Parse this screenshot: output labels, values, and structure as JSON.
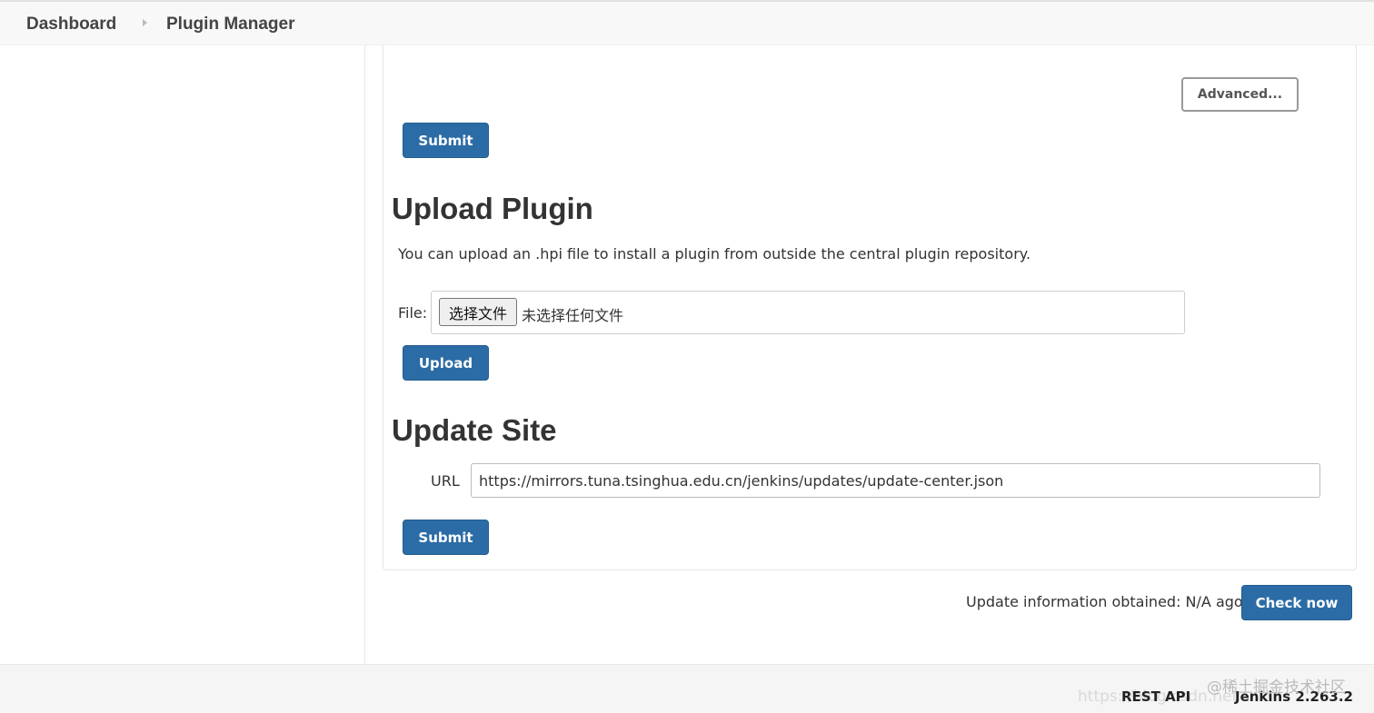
{
  "breadcrumb": {
    "items": [
      "Dashboard",
      "Plugin Manager"
    ]
  },
  "advanced": {
    "advanced_label": "Advanced...",
    "submit_label": "Submit"
  },
  "upload_plugin": {
    "title": "Upload Plugin",
    "description": "You can upload an .hpi file to install a plugin from outside the central plugin repository.",
    "file_label": "File:",
    "choose_file_label": "选择文件",
    "no_file_text": "未选择任何文件",
    "upload_label": "Upload"
  },
  "update_site": {
    "title": "Update Site",
    "url_label": "URL",
    "url_value": "https://mirrors.tuna.tsinghua.edu.cn/jenkins/updates/update-center.json",
    "submit_label": "Submit"
  },
  "update_info": {
    "text": "Update information obtained: N/A ago",
    "check_now_label": "Check now"
  },
  "footer": {
    "rest_api": "REST API",
    "version": "Jenkins 2.263.2",
    "watermark": "@稀土掘金技术社区",
    "watermark_url": "https://blog.csdn.net"
  },
  "colors": {
    "primary": "#2b6ca6",
    "text": "#333333",
    "background": "#ffffff"
  }
}
